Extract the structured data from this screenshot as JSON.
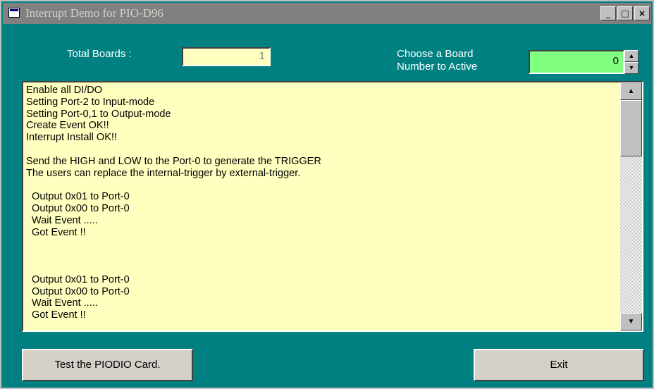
{
  "window": {
    "title": "Interrupt Demo for PIO-D96",
    "controls": {
      "minimize": "_",
      "maximize": "□",
      "close": "×"
    }
  },
  "header": {
    "total_boards_label": "Total Boards :",
    "total_boards_value": "1",
    "choose_board_label_line1": "Choose a Board",
    "choose_board_label_line2": "Number to Active",
    "board_number_value": "0",
    "spin_up_glyph": "▲",
    "spin_down_glyph": "▼"
  },
  "log": {
    "lines": [
      "Enable all DI/DO",
      "Setting Port-2 to Input-mode",
      "Setting Port-0,1 to Output-mode",
      "Create Event OK!!",
      "Interrupt Install OK!!",
      "",
      "Send the HIGH and LOW to the Port-0 to generate the TRIGGER",
      "The users can replace the internal-trigger by external-trigger.",
      "",
      "  Output 0x01 to Port-0",
      "  Output 0x00 to Port-0",
      "  Wait Event .....",
      "  Got Event !!",
      "",
      "",
      "",
      "  Output 0x01 to Port-0",
      "  Output 0x00 to Port-0",
      "  Wait Event .....",
      "  Got Event !!"
    ],
    "scroll_up_glyph": "▲",
    "scroll_down_glyph": "▼"
  },
  "buttons": {
    "test_label": "Test the PIODIO Card.",
    "exit_label": "Exit"
  },
  "colors": {
    "window_bg": "#008080",
    "titlebar_inactive": "#808080",
    "log_bg": "#ffffc0",
    "total_boards_field": "#ffffc0",
    "board_number_field": "#80ff80"
  }
}
